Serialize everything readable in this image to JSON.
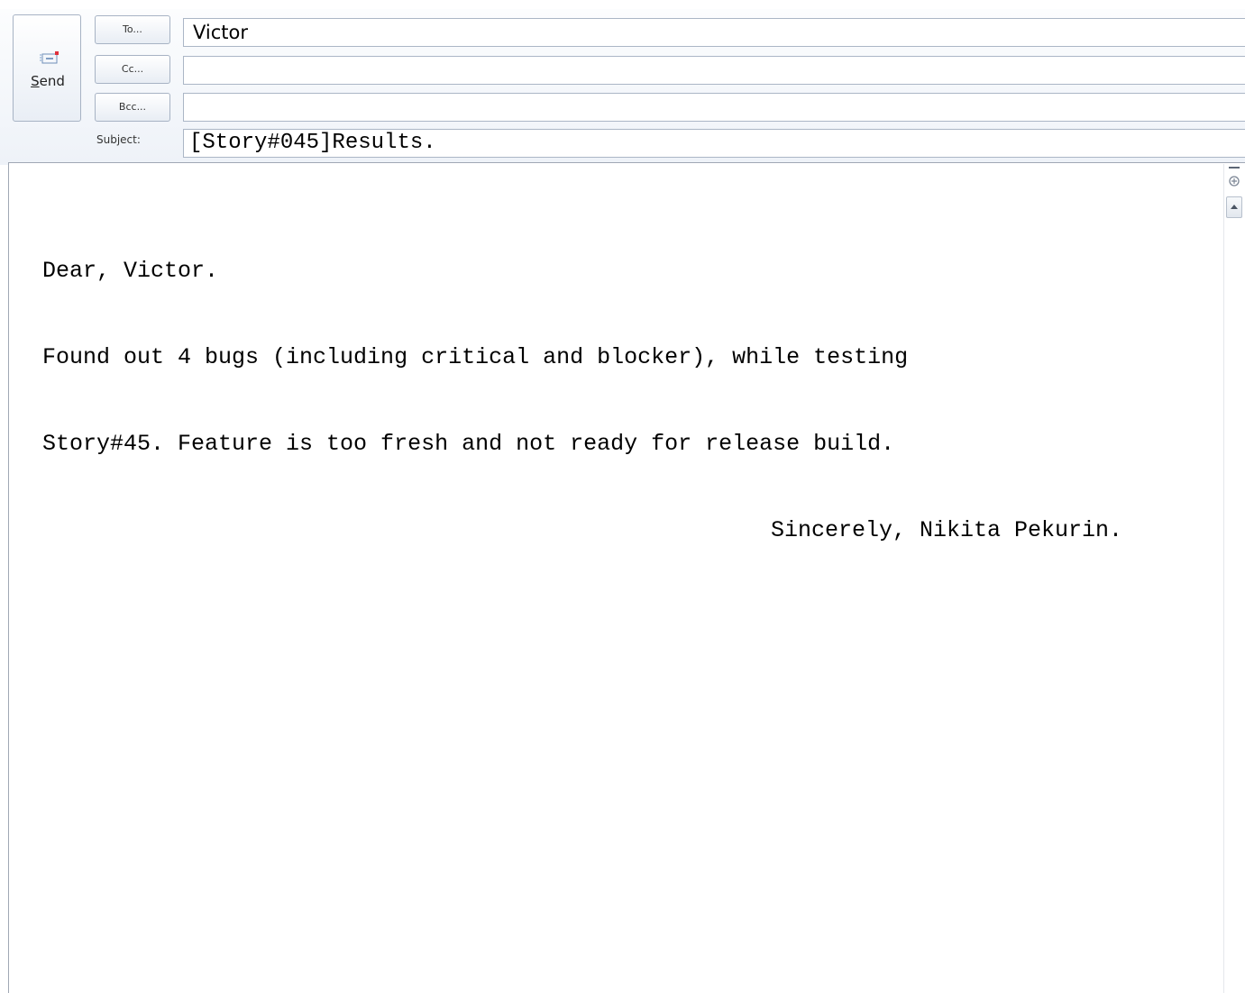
{
  "compose": {
    "send_button": {
      "label_accel": "S",
      "label_rest": "end",
      "icon": "envelope-send-icon"
    },
    "to_button": {
      "label": "To..."
    },
    "cc_button": {
      "label": "Cc..."
    },
    "bcc_button": {
      "label": "Bcc..."
    },
    "subject_label": "Subject:",
    "to_value": "Victor",
    "cc_value": "",
    "bcc_value": "",
    "subject_value": "[Story#045]Results.",
    "body": {
      "lines": [
        "Dear, Victor.",
        "Found out 4 bugs (including critical and blocker), while testing",
        "Story#45. Feature is too fresh and not ready for release build."
      ],
      "signature": "Sincerely, Nikita Pekurin."
    },
    "scrollbar": {
      "split_icon": "split-view-icon",
      "up_icon": "scroll-up-arrow-icon"
    }
  },
  "colors": {
    "header_bg": "#eef2f8",
    "button_border": "#a7b3c4",
    "field_border": "#abb6c6",
    "send_icon_accent": "#e0303a"
  }
}
